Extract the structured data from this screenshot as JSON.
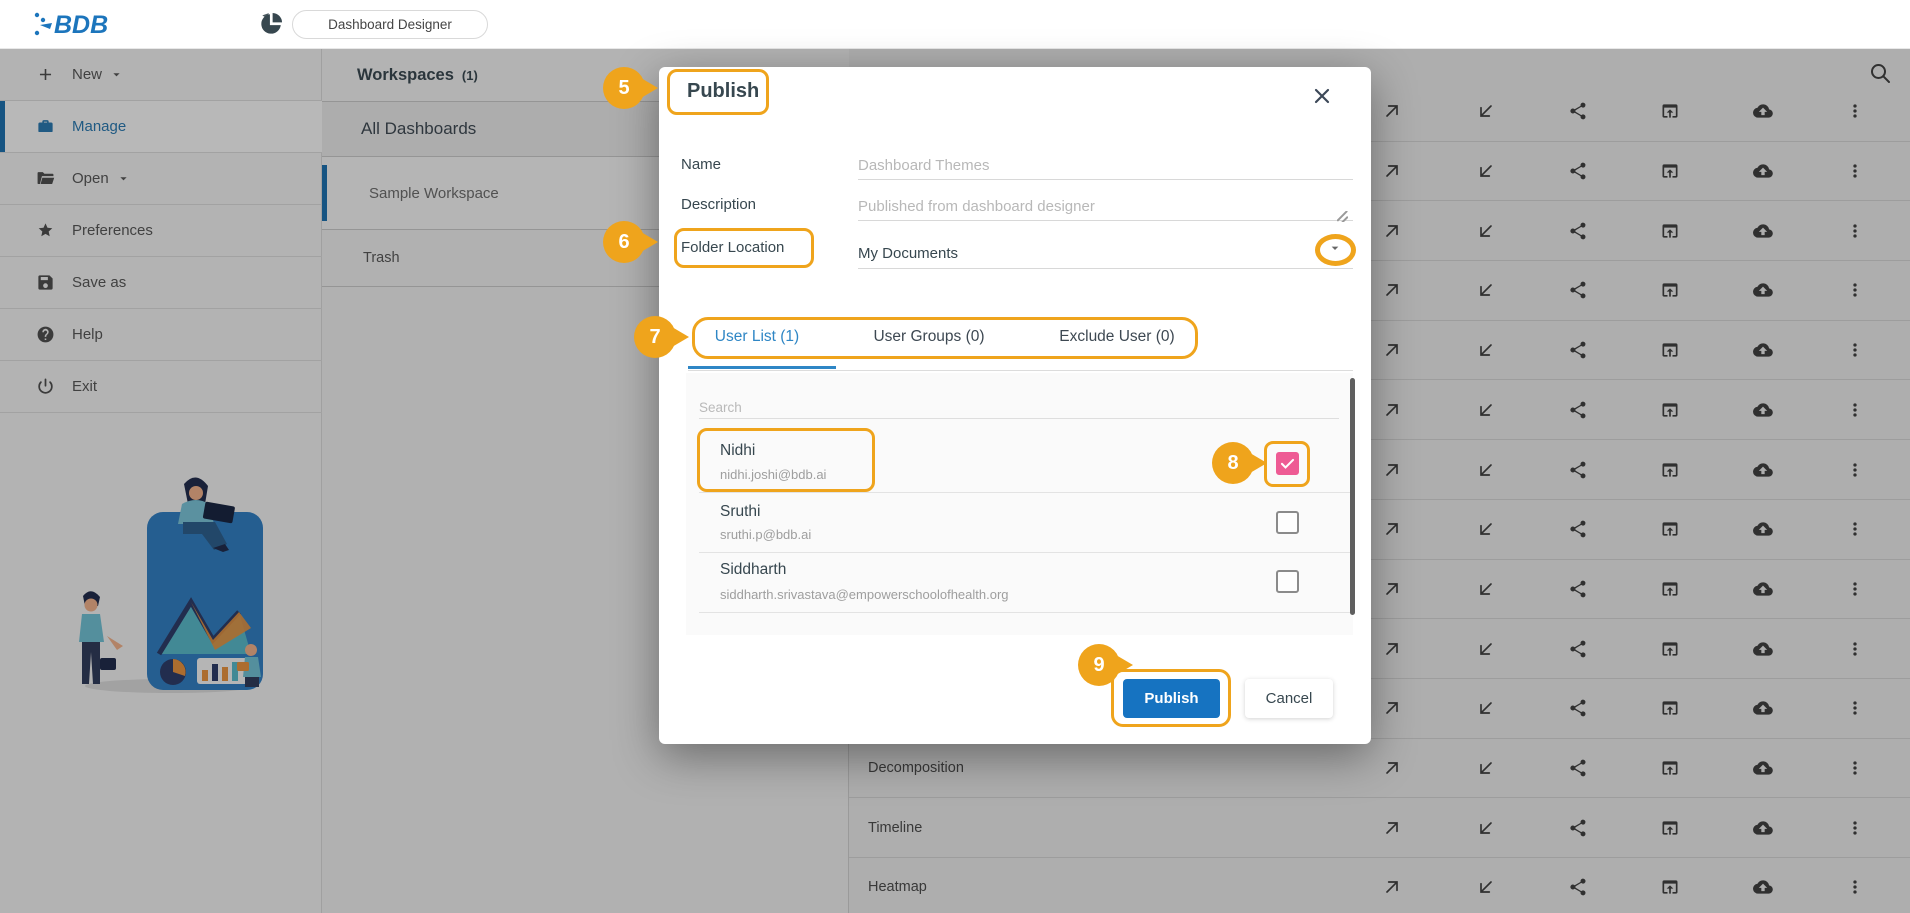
{
  "header": {
    "logo_text": "BDB",
    "app_title": "Dashboard Designer"
  },
  "sidebar": {
    "items": [
      {
        "label": "New",
        "icon": "plus-icon",
        "caret": true,
        "active": false
      },
      {
        "label": "Manage",
        "icon": "briefcase-icon",
        "caret": false,
        "active": true
      },
      {
        "label": "Open",
        "icon": "folder-open-icon",
        "caret": true,
        "active": false
      },
      {
        "label": "Preferences",
        "icon": "star-icon",
        "caret": false,
        "active": false
      },
      {
        "label": "Save as",
        "icon": "save-icon",
        "caret": false,
        "active": false
      },
      {
        "label": "Help",
        "icon": "help-icon",
        "caret": false,
        "active": false
      },
      {
        "label": "Exit",
        "icon": "power-icon",
        "caret": false,
        "active": false
      }
    ]
  },
  "workspaces": {
    "title": "Workspaces",
    "count": "(1)",
    "items": [
      {
        "label": "All Dashboards",
        "selected": false
      },
      {
        "label": "Sample Workspace",
        "selected": true
      },
      {
        "label": "Trash",
        "selected": false
      }
    ]
  },
  "dashboards_table": {
    "visible_row_count": 14,
    "row_labels": {
      "11": "Decomposition",
      "12": "Timeline",
      "13": "Heatmap"
    },
    "row_action_icons": [
      "open-in-new-tab-icon",
      "import-arrow-icon",
      "share-icon",
      "open-in-window-icon",
      "publish-cloud-icon",
      "more-options-icon"
    ],
    "search_icon": "search-icon"
  },
  "modal": {
    "title": "Publish",
    "fields": [
      {
        "label": "Name",
        "placeholder": "Dashboard Themes"
      },
      {
        "label": "Description",
        "placeholder": "Published from dashboard designer"
      },
      {
        "label": "Folder Location",
        "value": "My Documents"
      }
    ],
    "tabs": [
      {
        "label": "User List (1)",
        "active": true
      },
      {
        "label": "User Groups (0)",
        "active": false
      },
      {
        "label": "Exclude User (0)",
        "active": false
      }
    ],
    "search_placeholder": "Search",
    "users": [
      {
        "name": "Nidhi",
        "email": "nidhi.joshi@bdb.ai",
        "checked": true
      },
      {
        "name": "Sruthi",
        "email": "sruthi.p@bdb.ai",
        "checked": false
      },
      {
        "name": "Siddharth",
        "email": "siddharth.srivastava@empowerschoolofhealth.org",
        "checked": false
      }
    ],
    "buttons": {
      "publish": "Publish",
      "cancel": "Cancel"
    }
  },
  "annotations": {
    "badges": [
      "5",
      "6",
      "7",
      "8",
      "9"
    ]
  },
  "colors": {
    "accent_orange": "#EFA41C",
    "primary_blue": "#1673C1",
    "active_tab_blue": "#2E86C5",
    "checkbox_pink": "#EE5B94",
    "selected_bar_blue": "#1B6FAE"
  }
}
